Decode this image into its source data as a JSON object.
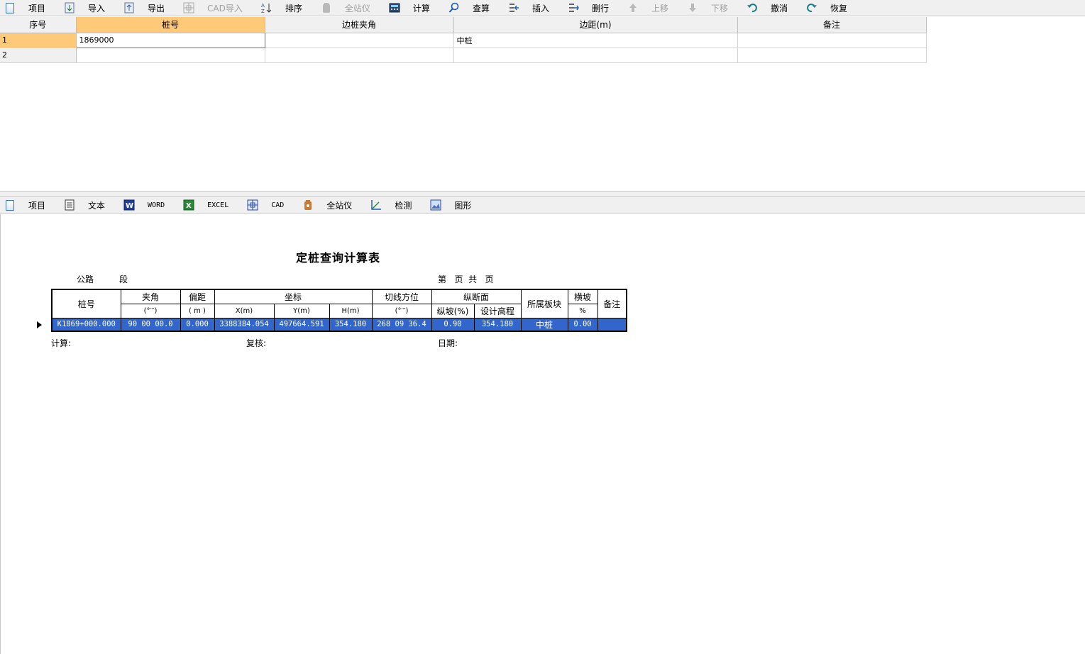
{
  "top_toolbar": [
    {
      "name": "project",
      "label": "项目",
      "icon": "doc-icon",
      "disabled": false
    },
    {
      "name": "import",
      "label": "导入",
      "icon": "import-icon",
      "disabled": false
    },
    {
      "name": "export",
      "label": "导出",
      "icon": "export-icon",
      "disabled": false
    },
    {
      "name": "cad-import",
      "label": "CAD导入",
      "icon": "cad-icon",
      "disabled": true
    },
    {
      "name": "sort",
      "label": "排序",
      "icon": "sort-az-icon",
      "disabled": false
    },
    {
      "name": "total-station",
      "label": "全站仪",
      "icon": "total-station-icon",
      "disabled": true
    },
    {
      "name": "calculate",
      "label": "计算",
      "icon": "calculator-icon",
      "disabled": false
    },
    {
      "name": "lookup",
      "label": "查算",
      "icon": "search-icon",
      "disabled": false
    },
    {
      "name": "insert",
      "label": "插入",
      "icon": "insert-row-icon",
      "disabled": false
    },
    {
      "name": "delete-row",
      "label": "删行",
      "icon": "delete-row-icon",
      "disabled": false
    },
    {
      "name": "move-up",
      "label": "上移",
      "icon": "arrow-up-icon",
      "disabled": true
    },
    {
      "name": "move-down",
      "label": "下移",
      "icon": "arrow-down-icon",
      "disabled": true
    },
    {
      "name": "undo",
      "label": "撤消",
      "icon": "undo-icon",
      "disabled": false
    },
    {
      "name": "redo",
      "label": "恢复",
      "icon": "redo-icon",
      "disabled": false
    }
  ],
  "grid": {
    "headers": [
      "序号",
      "桩号",
      "边桩夹角",
      "边距(m)",
      "备注"
    ],
    "rows": [
      {
        "seq": "1",
        "station": "1869000",
        "angle": "",
        "offset": "中桩",
        "note": ""
      },
      {
        "seq": "2",
        "station": "",
        "angle": "",
        "offset": "",
        "note": ""
      }
    ]
  },
  "bottom_toolbar": [
    {
      "name": "project",
      "label": "项目",
      "icon": "doc-icon"
    },
    {
      "name": "text",
      "label": "文本",
      "icon": "text-file-icon"
    },
    {
      "name": "word",
      "label": "WORD",
      "icon": "word-icon"
    },
    {
      "name": "excel",
      "label": "EXCEL",
      "icon": "excel-icon"
    },
    {
      "name": "cad",
      "label": "CAD",
      "icon": "cad-icon"
    },
    {
      "name": "total-station",
      "label": "全站仪",
      "icon": "total-station-icon"
    },
    {
      "name": "check",
      "label": "检测",
      "icon": "axis-chart-icon"
    },
    {
      "name": "graphic",
      "label": "图形",
      "icon": "image-icon"
    }
  ],
  "report": {
    "title": "定桩查询计算表",
    "road": "公路",
    "section": "段",
    "page_label": "第   页  共   页",
    "header_row1": {
      "station": "桩号",
      "angle": "夹角",
      "offset": "偏距",
      "coord": "坐标",
      "tangent": "切线方位",
      "profile": "纵断面",
      "block": "所属板块",
      "cross_slope": "横坡",
      "note": "备注"
    },
    "header_row2": {
      "angle_unit": "(°′″)",
      "offset_unit": "( m )",
      "x": "X(m)",
      "y": "Y(m)",
      "h": "H(m)",
      "tangent_unit": "(°′″)",
      "long_slope": "纵坡(%)",
      "design_elev": "设计高程",
      "cross_slope_unit": "%"
    },
    "row": {
      "station": "K1869+000.000",
      "angle": "90 00 00.0",
      "offset": "0.000",
      "x": "3388384.054",
      "y": "497664.591",
      "h": "354.180",
      "tangent": "268 09 36.4",
      "long_slope": "0.90",
      "design_elev": "354.180",
      "block": "中桩",
      "cross_slope": "0.00",
      "note": ""
    },
    "footer": {
      "calc": "计算:",
      "review": "复核:",
      "date": "日期:"
    },
    "selection_color": "#3366cc"
  }
}
